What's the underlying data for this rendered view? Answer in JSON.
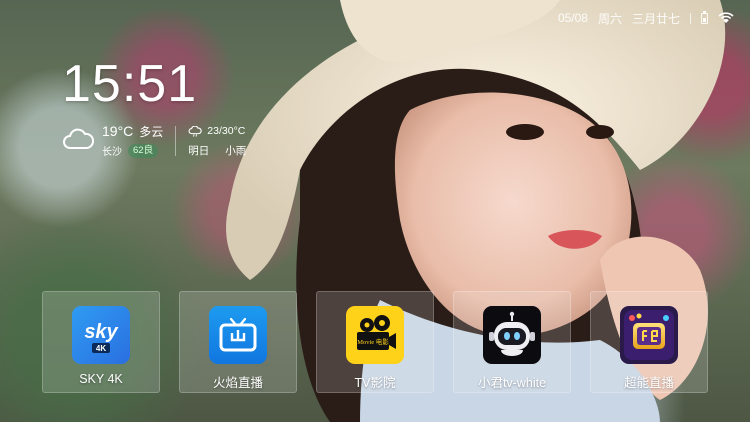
{
  "status_bar": {
    "date": "05/08",
    "weekday": "周六",
    "lunar_date": "三月廿七",
    "icons": [
      "battery-icon",
      "wifi-icon"
    ]
  },
  "clock": {
    "time": "15:51"
  },
  "weather": {
    "today": {
      "temperature": "19°C",
      "condition": "多云",
      "city": "长沙",
      "aqi": "62良",
      "icon": "cloud-icon"
    },
    "tomorrow": {
      "range": "23/30°C",
      "day": "明日",
      "condition": "小雨",
      "icon": "rain-cloud-icon"
    }
  },
  "apps": [
    {
      "label": "SKY 4K",
      "icon": "sky-4k-app-icon"
    },
    {
      "label": "火焰直播",
      "icon": "fire-live-tv-icon"
    },
    {
      "label": "TV影院",
      "icon": "tv-cinema-movie-icon"
    },
    {
      "label": "小君tv-white",
      "icon": "xiaojun-robot-icon"
    },
    {
      "label": "超能直播",
      "icon": "super-live-icon"
    }
  ],
  "icon_text": {
    "sky_word": "sky",
    "sky_badge": "4K",
    "movie_word": "Movie 电影"
  },
  "colors": {
    "tile_background": "rgba(240,240,240,0.18)",
    "aqi_badge": "#3c8c5a",
    "sky_blue": "#2a6fe0",
    "tv_yellow": "#ffd21a"
  }
}
